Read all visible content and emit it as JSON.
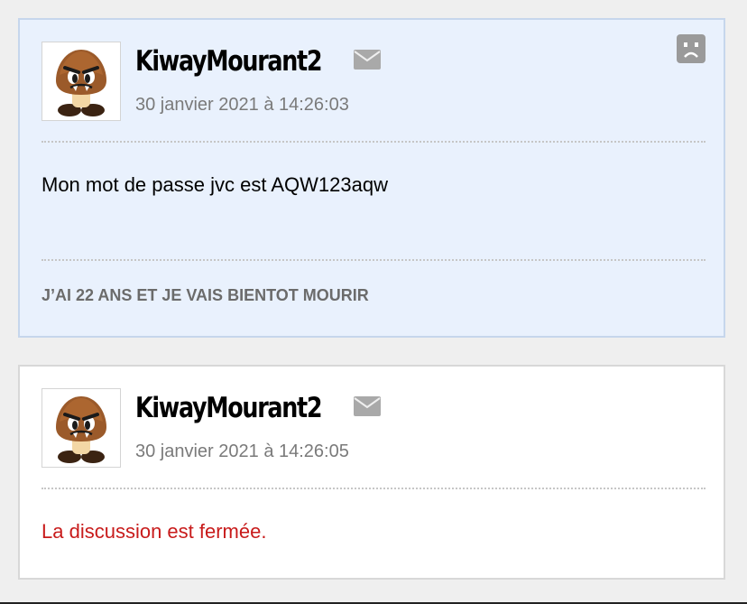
{
  "posts": [
    {
      "author": "KiwayMourant2",
      "date": "30 janvier 2021 à 14:26:03",
      "message": "Mon mot de passe jvc est AQW123aqw",
      "signature": "J’AI 22 ANS ET JE VAIS BIENTOT MOURIR",
      "avatar_icon": "goomba-avatar",
      "mail_icon": "envelope-icon",
      "report_icon": "sad-face-report-icon",
      "background": "#e9f1fd",
      "border": "#c6d6ec"
    },
    {
      "author": "KiwayMourant2",
      "date": "30 janvier 2021 à 14:26:05",
      "message": "La discussion est fermée.",
      "avatar_icon": "goomba-avatar",
      "mail_icon": "envelope-icon",
      "background": "#ffffff",
      "border": "#d8d8d8",
      "message_color": "#c81b1b"
    }
  ]
}
